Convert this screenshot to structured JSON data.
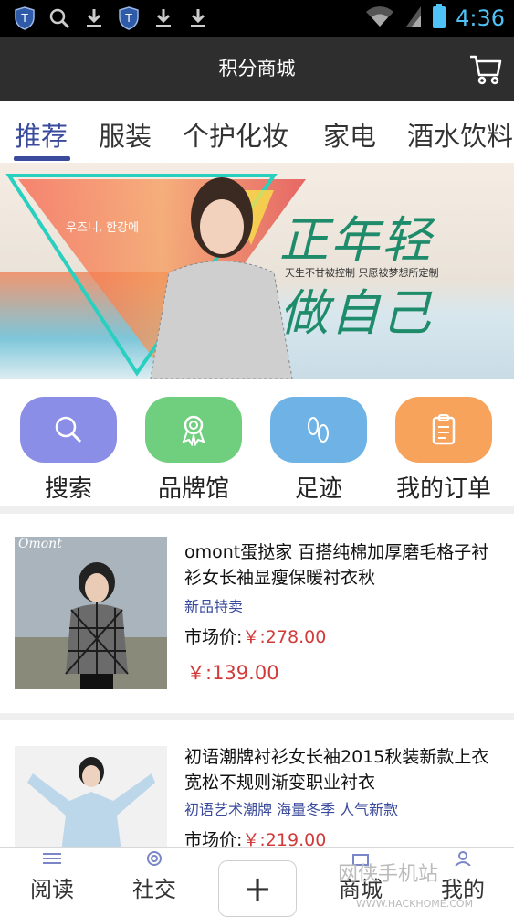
{
  "status": {
    "time": "4:36"
  },
  "header": {
    "title": "积分商城"
  },
  "tabs": [
    "推荐",
    "服装",
    "个护化妆",
    "家电",
    "酒水饮料"
  ],
  "banner": {
    "script_line1": "正年轻",
    "script_line2": "做自己",
    "tagline": "天生不甘被控制 只愿被梦想所定制",
    "korean": "우즈니, 한강에"
  },
  "quick_actions": [
    {
      "label": "搜索",
      "icon": "search-icon",
      "color": "#8b8ee6"
    },
    {
      "label": "品牌馆",
      "icon": "award-icon",
      "color": "#6fcf7e"
    },
    {
      "label": "足迹",
      "icon": "footprint-icon",
      "color": "#6fb3e6"
    },
    {
      "label": "我的订单",
      "icon": "clipboard-icon",
      "color": "#f7a35c"
    }
  ],
  "products": [
    {
      "title": "omont蛋挞家 百搭纯棉加厚磨毛格子衬衫女长袖显瘦保暖衬衣秋",
      "tag": "新品特卖",
      "market_label": "市场价:",
      "market_price": "￥:278.00",
      "price": "￥:139.00",
      "brand_logo": "Omont"
    },
    {
      "title": "初语潮牌衬衫女长袖2015秋装新款上衣 宽松不规则渐变职业衬衣",
      "tag": "初语艺术潮牌 海量冬季 人气新款",
      "market_label": "市场价:",
      "market_price": "￥:219.00"
    }
  ],
  "bottom_nav": {
    "items": [
      "阅读",
      "社交",
      "商城",
      "我的"
    ],
    "plus": "+"
  },
  "watermark": {
    "text": "网侠手机站",
    "url": "WWW.HACKHOME.COM"
  }
}
